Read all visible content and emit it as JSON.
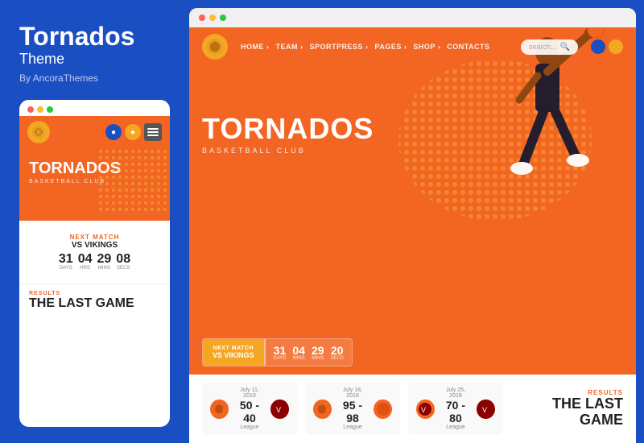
{
  "left": {
    "brand_title": "Tornados",
    "brand_subtitle": "Theme",
    "brand_by": "By AncoraThemes"
  },
  "mobile": {
    "dots": [
      "red",
      "yellow",
      "green"
    ],
    "hero_title": "TORNADOS",
    "hero_sub": "BASKETBALL CLUB",
    "next_match_label": "NEXT MATCH",
    "vs_label": "VS VIKINGS",
    "countdown": [
      {
        "num": "31",
        "label": "Days"
      },
      {
        "num": "04",
        "label": "Hrs"
      },
      {
        "num": "29",
        "label": "Mins"
      },
      {
        "num": "08",
        "label": "Secs"
      }
    ],
    "results_label": "RESULTS",
    "results_title": "THE LAST GAME"
  },
  "browser": {
    "dots": [
      "red",
      "yellow",
      "green"
    ],
    "nav": {
      "links": [
        "HOME ›",
        "TEAM ›",
        "SPORTPRESS ›",
        "PAGES ›",
        "SHOP ›",
        "CONTACTS"
      ],
      "search_placeholder": "search..."
    },
    "hero_title": "TORNADOS",
    "hero_sub": "BASKETBALL CLUB",
    "match_banner": {
      "next_label": "NEXT MATCH",
      "vs_label": "VS VIKINGS",
      "countdown": [
        {
          "num": "31",
          "label": "Days"
        },
        {
          "num": "04",
          "label": "Mins"
        },
        {
          "num": "29",
          "label": "Mins"
        },
        {
          "num": "20",
          "label": "Secs"
        }
      ]
    },
    "results": [
      {
        "date": "July 11, 2019",
        "score": "50 - 40",
        "league": "League",
        "home_team": "TOR",
        "away_team": "VIK"
      },
      {
        "date": "July 18, 2018",
        "score": "95 - 98",
        "league": "League",
        "home_team": "TOR",
        "away_team": "VIK"
      },
      {
        "date": "July 25, 2018",
        "score": "70 - 80",
        "league": "League",
        "home_team": "TOR",
        "away_team": "VIK"
      }
    ],
    "last_game_label": "RESULTS",
    "last_game_title": "THE LAST GAME"
  }
}
